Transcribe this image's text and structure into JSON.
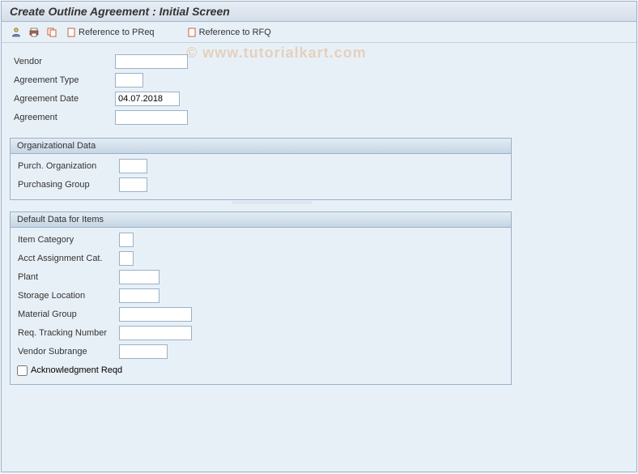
{
  "title": "Create Outline Agreement : Initial Screen",
  "watermark": "© www.tutorialkart.com",
  "toolbar": {
    "ref_preq": "Reference to PReq",
    "ref_rfq": "Reference to RFQ"
  },
  "fields": {
    "vendor": {
      "label": "Vendor",
      "value": ""
    },
    "agreement_type": {
      "label": "Agreement Type",
      "value": ""
    },
    "agreement_date": {
      "label": "Agreement Date",
      "value": "04.07.2018"
    },
    "agreement": {
      "label": "Agreement",
      "value": ""
    }
  },
  "org": {
    "title": "Organizational Data",
    "purch_org": {
      "label": "Purch. Organization",
      "value": ""
    },
    "purch_group": {
      "label": "Purchasing Group",
      "value": ""
    }
  },
  "defaults": {
    "title": "Default Data for Items",
    "item_cat": {
      "label": "Item Category",
      "value": ""
    },
    "acct_assign": {
      "label": "Acct Assignment Cat.",
      "value": ""
    },
    "plant": {
      "label": "Plant",
      "value": ""
    },
    "storage_loc": {
      "label": "Storage Location",
      "value": ""
    },
    "material_group": {
      "label": "Material Group",
      "value": ""
    },
    "req_tracking": {
      "label": "Req. Tracking Number",
      "value": ""
    },
    "vendor_subrange": {
      "label": "Vendor Subrange",
      "value": ""
    },
    "ack_reqd": {
      "label": "Acknowledgment Reqd",
      "checked": false
    }
  }
}
